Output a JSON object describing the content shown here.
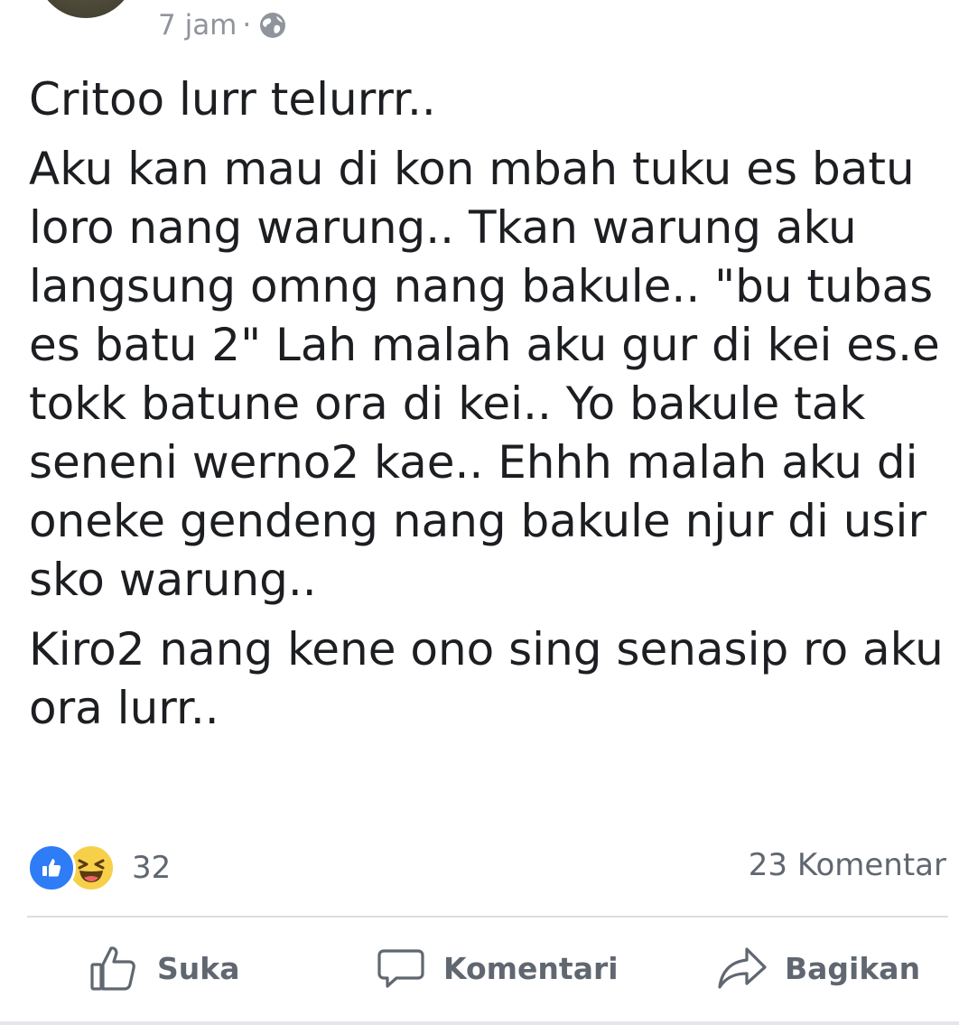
{
  "post": {
    "timestamp": "7 jam",
    "separator": "·",
    "privacy_icon": "globe-icon",
    "paragraphs": [
      "Critoo lurr telurrr..",
      "Aku kan mau di kon mbah tuku es batu loro nang warung.. Tkan warung aku langsung omng nang bakule.. \"bu tubas es batu 2\" Lah malah aku gur di kei es.e tokk batune ora di kei.. Yo bakule tak seneni werno2 kae.. Ehhh malah aku di oneke gendeng nang bakule njur di usir sko warung..",
      "Kiro2 nang kene ono sing senasip ro aku ora lurr.."
    ]
  },
  "stats": {
    "reaction_icons": [
      "like-icon",
      "haha-icon"
    ],
    "reaction_count": "32",
    "comment_count": "23 Komentar"
  },
  "actions": {
    "like_label": "Suka",
    "comment_label": "Komentari",
    "share_label": "Bagikan"
  },
  "colors": {
    "like_blue": "#2e7cf6",
    "haha_yellow": "#f7d04a",
    "meta_gray": "#90949c",
    "action_gray": "#606770"
  }
}
